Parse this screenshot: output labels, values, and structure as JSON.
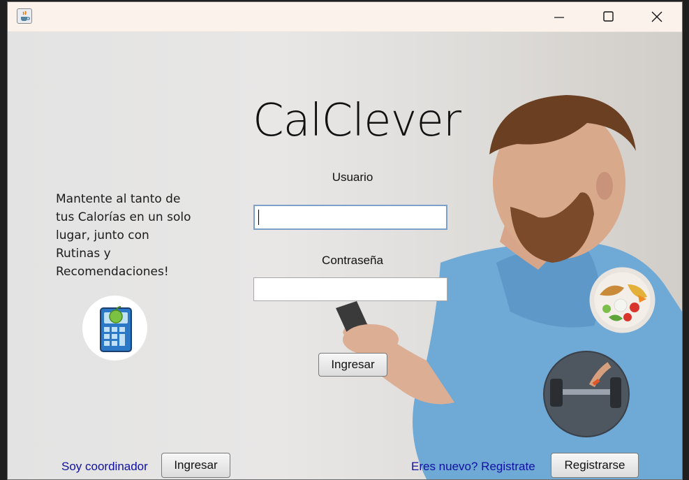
{
  "window": {
    "app_icon": "java-cup-icon",
    "controls": [
      "minimize-icon",
      "maximize-icon",
      "close-icon"
    ]
  },
  "app": {
    "title": "CalClever",
    "tagline": "Mantente al tanto de tus Calorías en un solo lugar, junto con Rutinas y Recomendaciones!"
  },
  "login": {
    "usuario_label": "Usuario",
    "usuario_value": "",
    "password_label": "Contraseña",
    "password_value": "",
    "submit_label": "Ingresar"
  },
  "footer": {
    "coordinator_text": "Soy coordinador",
    "coordinator_button": "Ingresar",
    "new_user_text": "Eres nuevo? Registrate",
    "register_button": "Registrarse"
  },
  "icons": {
    "calculator": "calculator-apple-icon",
    "salad": "salad-bowl-icon",
    "gym": "dumbbell-icon"
  },
  "colors": {
    "link": "#1010a0",
    "titlebar": "#fbf2ec",
    "input_focus": "#7ca0c8"
  }
}
